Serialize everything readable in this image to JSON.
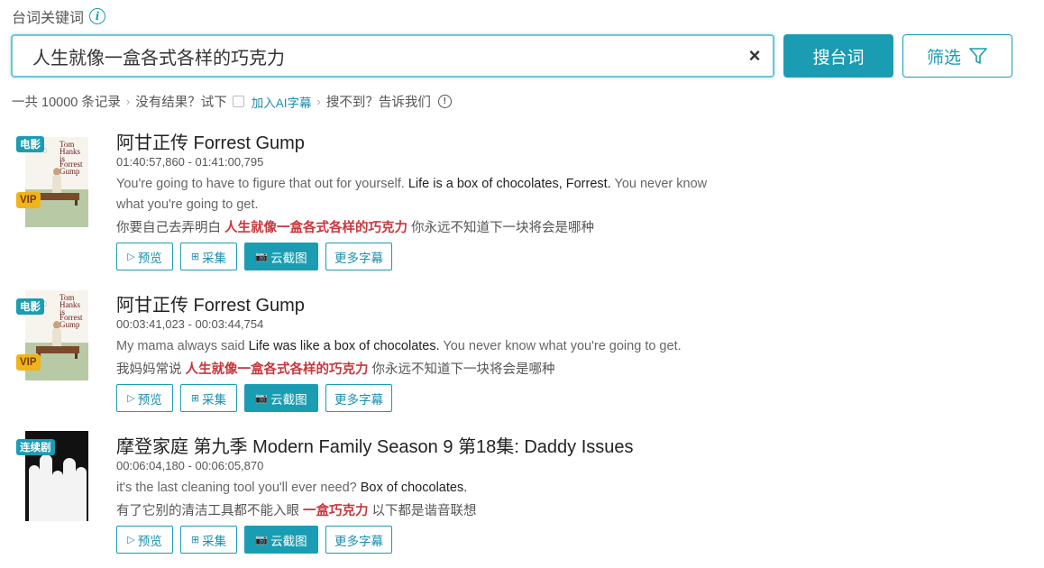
{
  "search": {
    "label": "台词关键词",
    "value": "人生就像一盒各式各样的巧克力",
    "clear_symbol": "×",
    "submit_label": "搜台词",
    "filter_label": "筛选"
  },
  "stats": {
    "total": "一共 10000 条记录",
    "no_result": "没有结果？试下",
    "ai_link": "加入AI字幕",
    "not_found": "搜不到？告诉我们"
  },
  "action_labels": {
    "preview": "预览",
    "collect": "采集",
    "screenshot": "云截图",
    "more": "更多字幕"
  },
  "results": [
    {
      "badge": "电影",
      "vip": "VIP",
      "poster_text": [
        "Tom",
        "Hanks",
        "is",
        "Forrest",
        "Gump"
      ],
      "title": "阿甘正传 Forrest Gump",
      "time": "01:40:57,860 - 01:41:00,795",
      "en_before": "You're going to have to figure that out for yourself.  ",
      "en_highlight": "Life is a box of chocolates, Forrest.",
      "en_after": " You never know what you're going to get.",
      "zh_before": "你要自己去弄明白  ",
      "zh_highlight": "人生就像一盒各式各样的巧克力",
      "zh_after": "  你永远不知道下一块将会是哪种"
    },
    {
      "badge": "电影",
      "vip": "VIP",
      "poster_text": [
        "Tom",
        "Hanks",
        "is",
        "Forrest",
        "Gump"
      ],
      "title": "阿甘正传 Forrest Gump",
      "time": "00:03:41,023 - 00:03:44,754",
      "en_before": "My mama always said  ",
      "en_highlight": "Life was like a box of chocolates.",
      "en_after": " You never know what you're going to get.",
      "zh_before": "我妈妈常说  ",
      "zh_highlight": "人生就像一盒各式各样的巧克力",
      "zh_after": "  你永远不知道下一块将会是哪种"
    },
    {
      "badge": "连续剧",
      "title": "摩登家庭 第九季 Modern Family Season 9 第18集: Daddy Issues",
      "time": "00:06:04,180 - 00:06:05,870",
      "en_before": "it's the last cleaning tool you'll ever need?  ",
      "en_highlight": "Box of chocolates.",
      "en_after": "",
      "zh_before": "有了它别的清洁工具都不能入眼  ",
      "zh_highlight": "一盒巧克力",
      "zh_after": "  以下都是谐音联想"
    }
  ]
}
